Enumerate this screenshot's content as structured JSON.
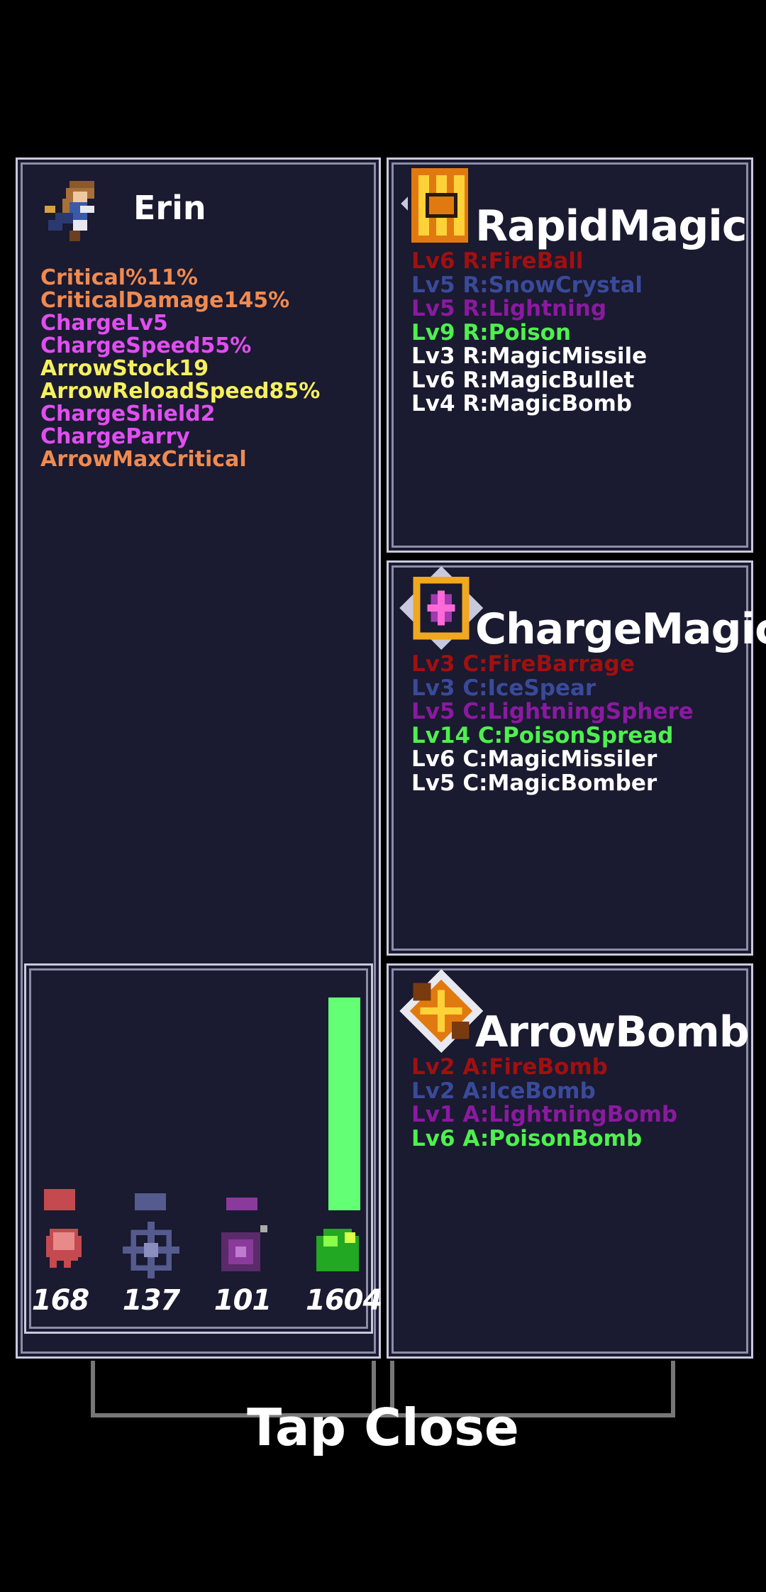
{
  "character": {
    "name": "Erin",
    "stats": [
      {
        "text": "Critical%11%",
        "color": "#f08a50"
      },
      {
        "text": "CriticalDamage145%",
        "color": "#f08a50"
      },
      {
        "text": "ChargeLv5",
        "color": "#e04ef0"
      },
      {
        "text": "ChargeSpeed55%",
        "color": "#e04ef0"
      },
      {
        "text": "ArrowStock19",
        "color": "#f5f060"
      },
      {
        "text": "ArrowReloadSpeed85%",
        "color": "#f5f060"
      },
      {
        "text": "ChargeShield2",
        "color": "#e04ef0"
      },
      {
        "text": "ChargeParry",
        "color": "#e04ef0"
      },
      {
        "text": "ArrowMaxCritical",
        "color": "#f08a50"
      }
    ]
  },
  "resources": [
    {
      "icon": "fire-ghost-icon",
      "count": "168",
      "color": "#c44a4f",
      "fill": 0.1
    },
    {
      "icon": "ice-web-icon",
      "count": "137",
      "color": "#555a8f",
      "fill": 0.08
    },
    {
      "icon": "lightning-orb-icon",
      "count": "101",
      "color": "#8a3a9a",
      "fill": 0.06
    },
    {
      "icon": "poison-blob-icon",
      "count": "1604",
      "color": "#63ff75",
      "fill": 1.0
    }
  ],
  "skills": [
    {
      "title": "RapidMagic",
      "icon": "rapid-magic-icon",
      "lines": [
        {
          "text": "Lv6 R:FireBall",
          "color": "#a01010"
        },
        {
          "text": "Lv5 R:SnowCrystal",
          "color": "#3a4a9a"
        },
        {
          "text": "Lv5 R:Lightning",
          "color": "#8a1aa0"
        },
        {
          "text": "Lv9 R:Poison",
          "color": "#4ef04e"
        },
        {
          "text": "Lv3 R:MagicMissile",
          "color": "#ffffff"
        },
        {
          "text": "Lv6 R:MagicBullet",
          "color": "#ffffff"
        },
        {
          "text": "Lv4 R:MagicBomb",
          "color": "#ffffff"
        }
      ]
    },
    {
      "title": "ChargeMagic",
      "icon": "charge-magic-icon",
      "lines": [
        {
          "text": "Lv3 C:FireBarrage",
          "color": "#a01010"
        },
        {
          "text": "Lv3 C:IceSpear",
          "color": "#3a4a9a"
        },
        {
          "text": "Lv5 C:LightningSphere",
          "color": "#8a1aa0"
        },
        {
          "text": "Lv14 C:PoisonSpread",
          "color": "#4ef04e"
        },
        {
          "text": "Lv6 C:MagicMissiler",
          "color": "#ffffff"
        },
        {
          "text": "Lv5 C:MagicBomber",
          "color": "#ffffff"
        }
      ]
    },
    {
      "title": "ArrowBomb",
      "icon": "arrow-bomb-icon",
      "lines": [
        {
          "text": "Lv2 A:FireBomb",
          "color": "#a01010"
        },
        {
          "text": "Lv2 A:IceBomb",
          "color": "#3a4a9a"
        },
        {
          "text": "Lv1 A:LightningBomb",
          "color": "#8a1aa0"
        },
        {
          "text": "Lv6 A:PoisonBomb",
          "color": "#4ef04e"
        }
      ]
    }
  ],
  "footer": {
    "close_label": "Tap Close"
  }
}
